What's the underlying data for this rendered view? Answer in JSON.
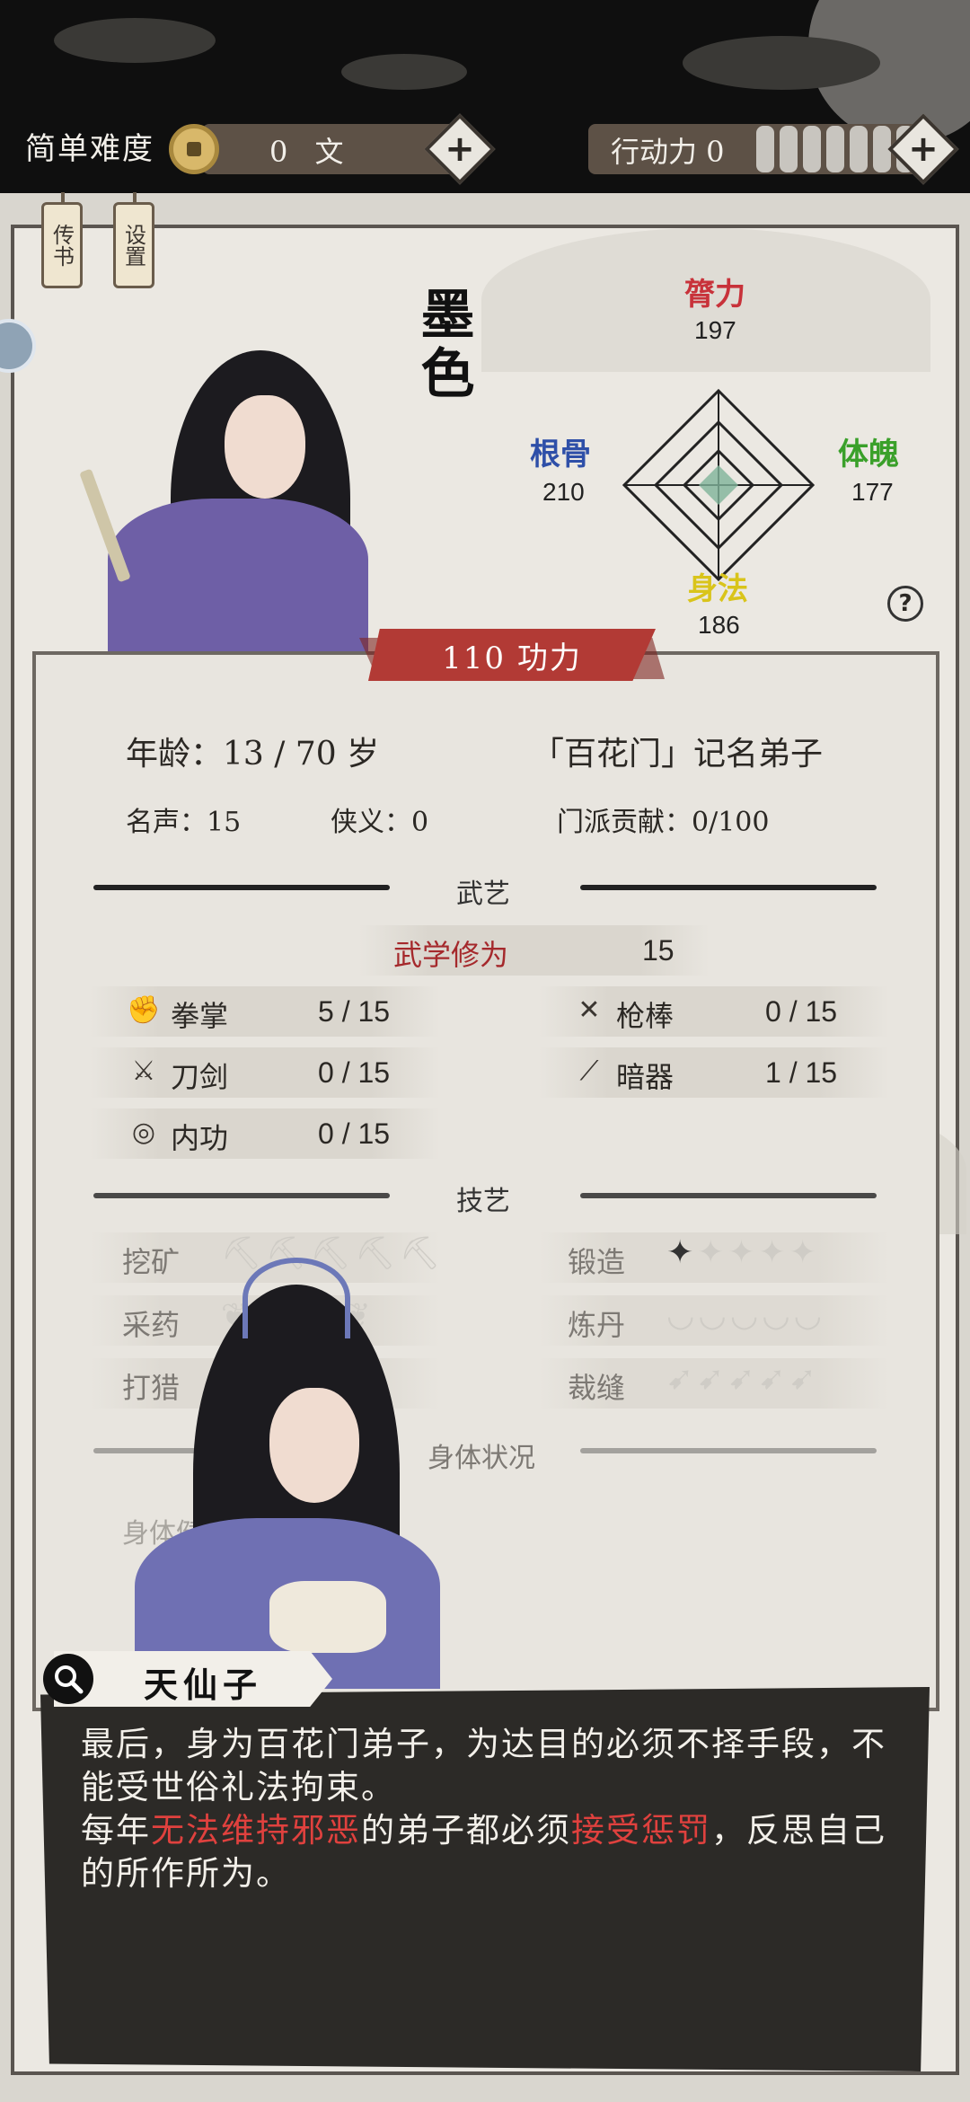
{
  "topbar": {
    "difficulty": "简单难度",
    "coins": "0 文",
    "action_label": "行动力 0",
    "action_pips": 7
  },
  "tags": {
    "biography": "传书",
    "settings": "设置"
  },
  "character": {
    "name": "墨色",
    "power": "110 功力",
    "stats": {
      "strength_label": "膂力",
      "strength": "197",
      "root_label": "根骨",
      "root": "210",
      "physique_label": "体魄",
      "physique": "177",
      "agility_label": "身法",
      "agility": "186"
    },
    "age": "年龄：13 / 70 岁",
    "sect": "「百花门」记名弟子",
    "fame": "名声：15",
    "chivalry": "侠义：0",
    "contribution": "门派贡献：0/100"
  },
  "martial": {
    "title": "武艺",
    "cultivation_label": "武学修为",
    "cultivation_value": "15",
    "skills": [
      {
        "name": "拳掌",
        "value": "5 / 15",
        "icon": "fist-icon"
      },
      {
        "name": "枪棒",
        "value": "0 / 15",
        "icon": "crossed-spears-icon"
      },
      {
        "name": "刀剑",
        "value": "0 / 15",
        "icon": "crossed-swords-icon"
      },
      {
        "name": "暗器",
        "value": "1 / 15",
        "icon": "hidden-weapon-icon"
      },
      {
        "name": "内功",
        "value": "0 / 15",
        "icon": "inner-energy-icon"
      }
    ]
  },
  "crafts": {
    "title": "技艺",
    "items": [
      {
        "name": "挖矿",
        "icon": "pickaxe-icon"
      },
      {
        "name": "锻造",
        "icon": "anvil-icon"
      },
      {
        "name": "采药",
        "icon": "herb-icon"
      },
      {
        "name": "炼丹",
        "icon": "mortar-icon"
      },
      {
        "name": "打猎",
        "icon": "arrow-icon"
      },
      {
        "name": "裁缝",
        "icon": "needle-icon"
      }
    ]
  },
  "body": {
    "title": "身体状况",
    "health_label": "身体健康"
  },
  "dialog": {
    "speaker": "天仙子",
    "line1": "最后，身为百花门弟子，为达目的必须不择手段，不能受世俗礼法拘束。",
    "line2_a": "每年",
    "line2_b": "无法维持邪恶",
    "line2_c": "的弟子都必须",
    "line2_d": "接受惩罚",
    "line2_e": "，反思自己的所作所为。"
  },
  "colors": {
    "strength": "#c8323a",
    "root": "#2e4fa8",
    "physique": "#3aa02a",
    "agility": "#d9c41a",
    "banner": "#b23a35",
    "highlight_red": "#e0413e"
  }
}
